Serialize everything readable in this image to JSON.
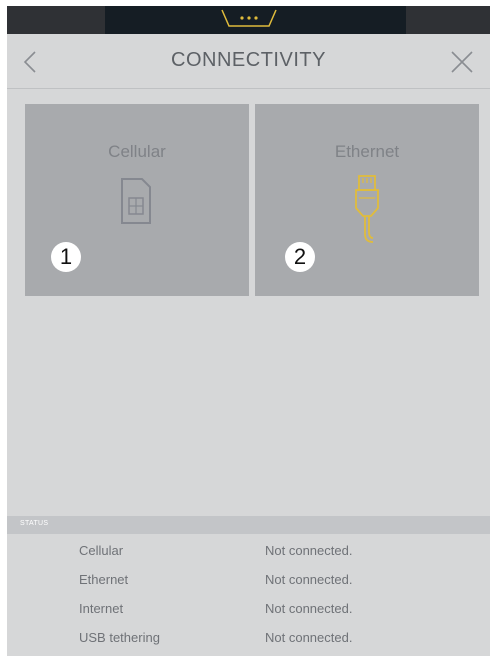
{
  "header": {
    "title": "CONNECTIVITY"
  },
  "tiles": [
    {
      "label": "Cellular",
      "badge": "1",
      "icon": "sim-card-icon",
      "icon_color": "#7f8287"
    },
    {
      "label": "Ethernet",
      "badge": "2",
      "icon": "ethernet-cable-icon",
      "icon_color": "#e0bc3c"
    }
  ],
  "status": {
    "heading": "STATUS",
    "rows": [
      {
        "name": "Cellular",
        "value": "Not connected."
      },
      {
        "name": "Ethernet",
        "value": "Not connected."
      },
      {
        "name": "Internet",
        "value": "Not connected."
      },
      {
        "name": "USB tethering",
        "value": "Not connected."
      }
    ]
  },
  "colors": {
    "background": "#d6d7d8",
    "tile": "#a8aaad",
    "topbar": "#151d24",
    "accent": "#e0bc3c"
  }
}
